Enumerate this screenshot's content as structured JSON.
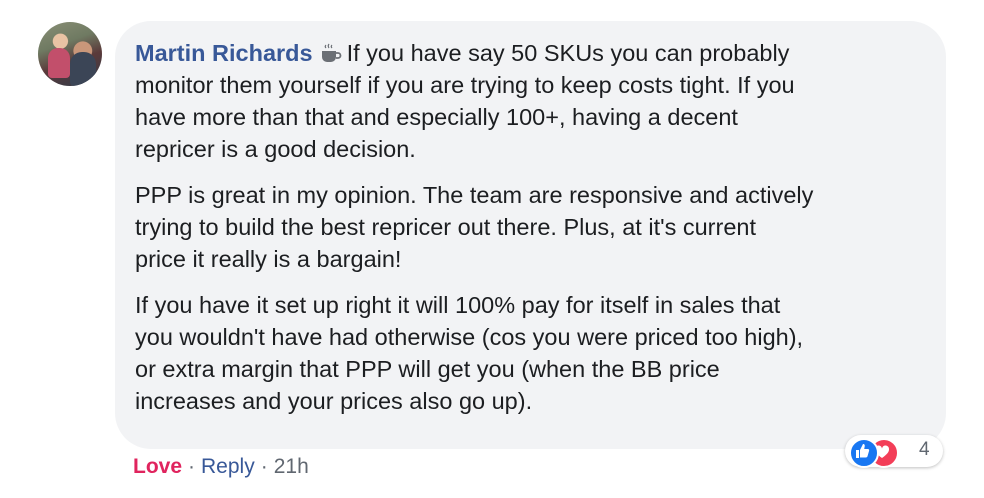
{
  "comment": {
    "author": "Martin Richards",
    "badge_icon": "coffee-cup-icon",
    "paragraphs": [
      "If you have say 50 SKUs you can probably\nmonitor them yourself if you are trying to keep costs tight. If you\nhave more than that and especially 100+, having a decent\nrepricer is a good decision.",
      "PPP is great in my opinion. The team are responsive and actively\ntrying to build the best repricer out there. Plus, at it's current\nprice it really is a bargain!",
      "If you have it set up right it will 100% pay for itself in sales that\nyou wouldn't have had otherwise (cos you were priced too high),\nor extra margin that PPP will get you (when the BB price\nincreases and your prices also go up)."
    ]
  },
  "actions": {
    "love": "Love",
    "separator": "·",
    "reply": "Reply",
    "time": "21h"
  },
  "reactions": {
    "types": [
      "like-icon",
      "heart-icon"
    ],
    "count": "4"
  },
  "colors": {
    "author": "#385898",
    "love": "#e0245e",
    "bubble_bg": "#f2f3f5",
    "like": "#1877f2",
    "heart": "#f33e58"
  }
}
